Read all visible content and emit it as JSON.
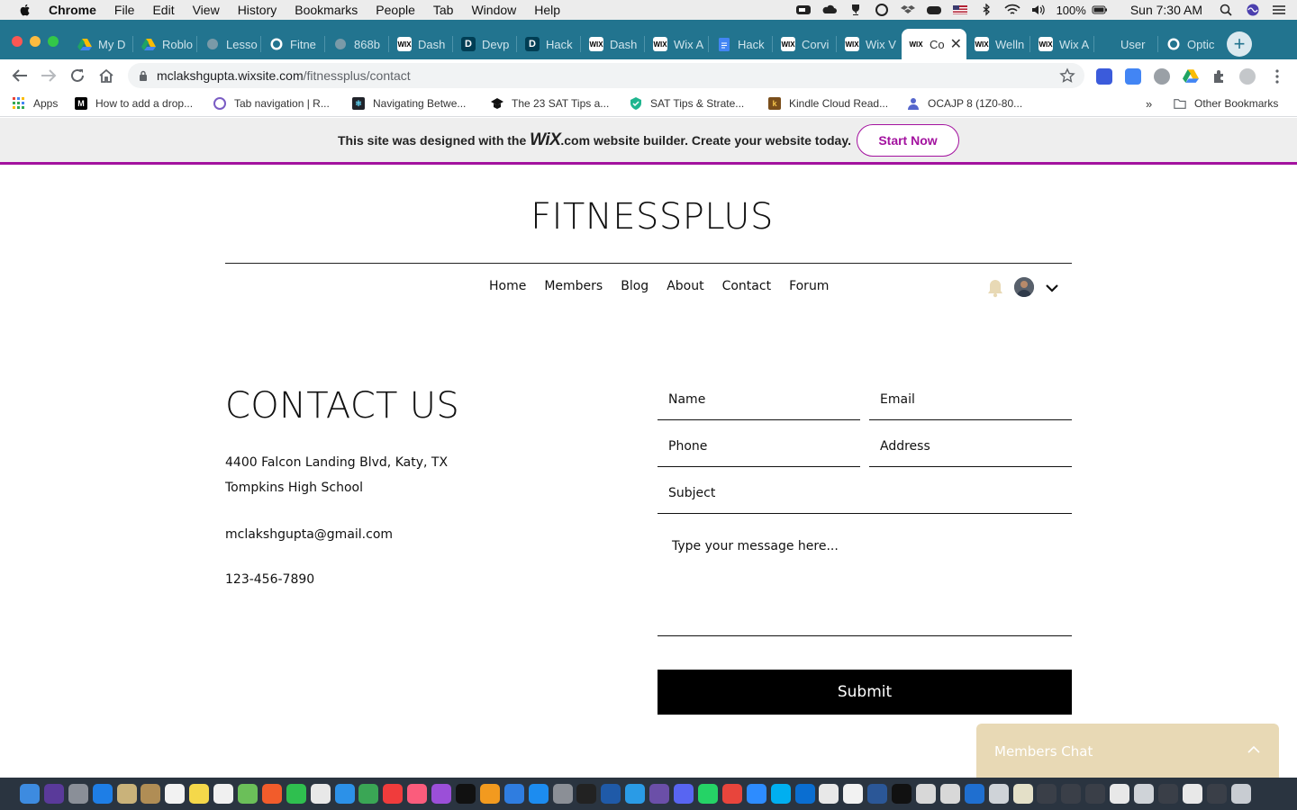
{
  "menubar": {
    "app_name": "Chrome",
    "items": [
      "File",
      "Edit",
      "View",
      "History",
      "Bookmarks",
      "People",
      "Tab",
      "Window",
      "Help"
    ],
    "battery": "100%",
    "clock": "Sun 7:30 AM"
  },
  "tabs": [
    {
      "label": "My D",
      "favicon": "google-drive-icon"
    },
    {
      "label": "Roblo",
      "favicon": "google-drive-icon"
    },
    {
      "label": "Lesso",
      "favicon": "globe-icon"
    },
    {
      "label": "Fitne",
      "favicon": "github-icon"
    },
    {
      "label": "868b",
      "favicon": "globe-icon"
    },
    {
      "label": "Dash",
      "favicon": "wix-icon"
    },
    {
      "label": "Devp",
      "favicon": "devpost-icon"
    },
    {
      "label": "Hack",
      "favicon": "devpost-icon"
    },
    {
      "label": "Dash",
      "favicon": "wix-icon"
    },
    {
      "label": "Wix A",
      "favicon": "wix-icon"
    },
    {
      "label": "Hack",
      "favicon": "google-docs-icon"
    },
    {
      "label": "Corvi",
      "favicon": "wix-icon"
    },
    {
      "label": "Wix V",
      "favicon": "wix-icon"
    },
    {
      "label": "Co",
      "favicon": "wix-icon",
      "active": true
    },
    {
      "label": "Welln",
      "favicon": "wix-icon"
    },
    {
      "label": "Wix A",
      "favicon": "wix-icon"
    },
    {
      "label": "User",
      "favicon": "blank"
    },
    {
      "label": "Optic",
      "favicon": "github-icon"
    }
  ],
  "omnibox": {
    "host": "mclakshgupta.wixsite.com",
    "path": "/fitnessplus/contact"
  },
  "bookmarks": [
    {
      "label": "Apps",
      "icon": "apps-grid-icon"
    },
    {
      "label": "How to add a drop...",
      "icon": "medium-icon"
    },
    {
      "label": "Tab navigation | R...",
      "icon": "globe-icon"
    },
    {
      "label": "Navigating Betwe...",
      "icon": "react-icon"
    },
    {
      "label": "The 23 SAT Tips a...",
      "icon": "graduation-cap-icon"
    },
    {
      "label": "SAT Tips & Strate...",
      "icon": "check-shield-icon"
    },
    {
      "label": "Kindle Cloud Read...",
      "icon": "kindle-icon"
    },
    {
      "label": "OCAJP 8 (1Z0-80...",
      "icon": "person-icon"
    }
  ],
  "bookmarks_more": "»",
  "other_bookmarks": "Other Bookmarks",
  "wix_banner": {
    "before": "This site was designed with the",
    "logo": "WiX",
    "after": ".com website builder. Create your website today.",
    "button": "Start Now"
  },
  "site": {
    "title": "FITNESSPLUS",
    "nav": [
      "Home",
      "Members",
      "Blog",
      "About",
      "Contact",
      "Forum"
    ]
  },
  "contact": {
    "heading": "CONTACT US",
    "address_line1": "4400 Falcon Landing Blvd, Katy, TX",
    "address_line2": "Tompkins High School",
    "email": "mclakshgupta@gmail.com",
    "phone": "123-456-7890"
  },
  "form": {
    "name_placeholder": "Name",
    "email_placeholder": "Email",
    "phone_placeholder": "Phone",
    "address_placeholder": "Address",
    "subject_placeholder": "Subject",
    "message_placeholder": "Type your message here...",
    "submit_label": "Submit"
  },
  "members_chat": {
    "label": "Members Chat"
  },
  "colors": {
    "tabstrip": "#22748f",
    "wix_accent": "#a3129f",
    "chat_bg": "#e8d9b5",
    "submit_bg": "#000000"
  }
}
